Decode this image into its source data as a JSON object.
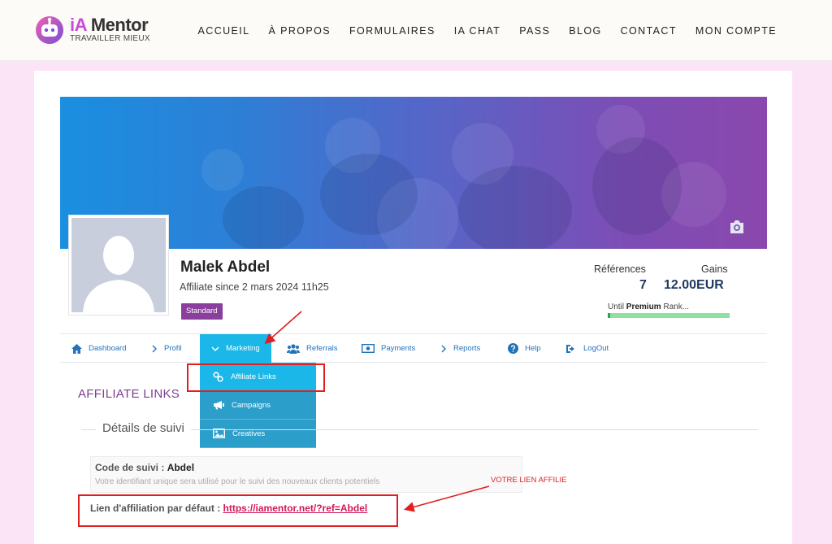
{
  "brand": {
    "title_a": "iA",
    "title_b": "Mentor",
    "tagline": "TRAVAILLER MIEUX",
    "accent": "#c84bd6"
  },
  "main_nav": [
    "ACCUEIL",
    "À PROPOS",
    "FORMULAIRES",
    "IA CHAT",
    "PASS",
    "BLOG",
    "CONTACT",
    "MON COMPTE"
  ],
  "profile": {
    "name": "Malek Abdel",
    "since": "Affiliate since 2 mars 2024 11h25",
    "badge": "Standard",
    "badge_color": "#8b3f9c"
  },
  "stats": {
    "references_label": "Références",
    "gains_label": "Gains",
    "references_value": "7",
    "gains_value": "12.00EUR",
    "rank_prefix": "Until ",
    "rank_bold": "Premium",
    "rank_suffix": " Rank...",
    "rank_progress": 0.02
  },
  "profile_nav": {
    "dashboard": "Dashboard",
    "profil": "Profil",
    "marketing": "Marketing",
    "referrals": "Referrals",
    "payments": "Payments",
    "reports": "Reports",
    "help": "Help",
    "logout": "LogOut",
    "link_color": "#2473b8",
    "active_color": "#1bb7e8"
  },
  "marketing_menu": {
    "affiliate_links": "Affiliate Links",
    "campaigns": "Campaigns",
    "creatives": "Creatives"
  },
  "section": {
    "title": "AFFILIATE LINKS",
    "subtitle": "Détails de suivi"
  },
  "tracking": {
    "code_label": "Code de suivi : ",
    "code_value": "Abdel",
    "code_hint": "Votre identifiant unique sera utilisé pour le suivi des nouveaux clients potentiels",
    "link_label": "Lien d'affiliation par défaut : ",
    "link_value": "https://iamentor.net/?ref=Abdel"
  },
  "annotation": {
    "label": "VOTRE LIEN AFFILIE",
    "color": "#e02020"
  }
}
